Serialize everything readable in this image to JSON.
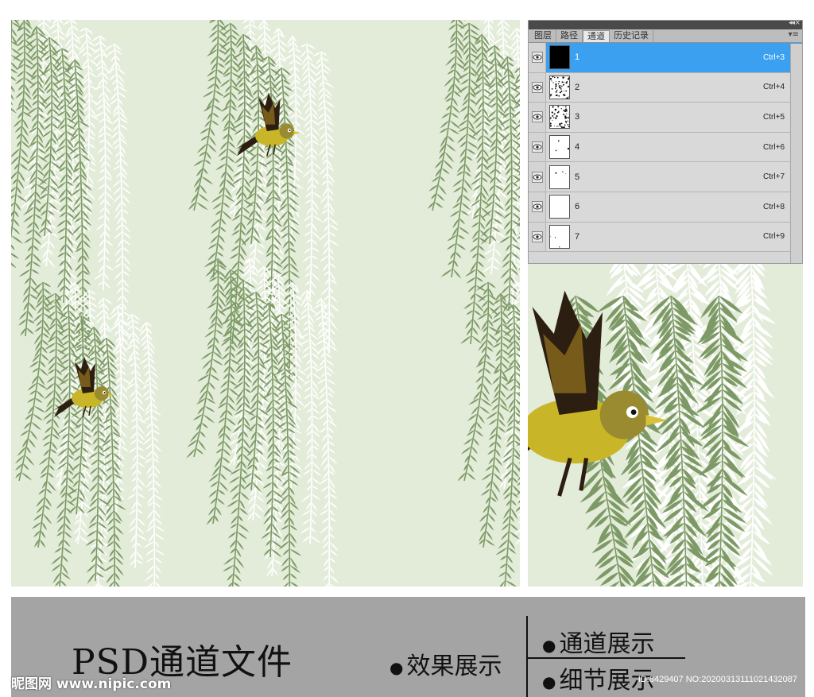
{
  "panel": {
    "tabs": [
      "图层",
      "路径",
      "通道",
      "历史记录"
    ],
    "active_tab": "通道",
    "channels": [
      {
        "name": "1",
        "shortcut": "Ctrl+3",
        "selected": true,
        "thumb": "black"
      },
      {
        "name": "2",
        "shortcut": "Ctrl+4",
        "selected": false,
        "thumb": "speckle-heavy"
      },
      {
        "name": "3",
        "shortcut": "Ctrl+5",
        "selected": false,
        "thumb": "speckle-heavy"
      },
      {
        "name": "4",
        "shortcut": "Ctrl+6",
        "selected": false,
        "thumb": "speckle-light"
      },
      {
        "name": "5",
        "shortcut": "Ctrl+7",
        "selected": false,
        "thumb": "speckle-light"
      },
      {
        "name": "6",
        "shortcut": "Ctrl+8",
        "selected": false,
        "thumb": "blank"
      },
      {
        "name": "7",
        "shortcut": "Ctrl+9",
        "selected": false,
        "thumb": "speckle-light"
      }
    ]
  },
  "banner": {
    "title": "PSD通道文件",
    "item_effect": "效果展示",
    "item_channel": "通道展示",
    "item_detail": "细节展示",
    "watermark_site": "昵图网 www.nipic.com",
    "watermark_id": "ID:8429407 NO:20200313111021432087"
  },
  "colors": {
    "background": "#e3ecd9",
    "leaf_dark": "#7d9a66",
    "leaf_light": "#ffffff",
    "bird_yellow": "#c9b628",
    "bird_dark": "#2c1e10",
    "banner": "#a4a4a4",
    "selected_row": "#3ba0f0"
  }
}
